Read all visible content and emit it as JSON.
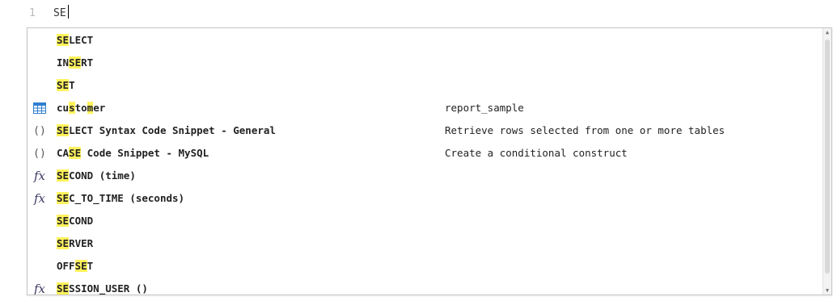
{
  "editor": {
    "line_number": "1",
    "text": "SE"
  },
  "autocomplete": {
    "items": [
      {
        "icon": "none",
        "label": "SELECT",
        "highlights": [
          [
            0,
            2
          ]
        ],
        "detail": ""
      },
      {
        "icon": "none",
        "label": "INSERT",
        "highlights": [
          [
            2,
            4
          ]
        ],
        "detail": ""
      },
      {
        "icon": "none",
        "label": "SET",
        "highlights": [
          [
            0,
            2
          ]
        ],
        "detail": ""
      },
      {
        "icon": "table-icon",
        "label": "customer",
        "highlights": [
          [
            2,
            3
          ],
          [
            5,
            6
          ]
        ],
        "detail": "report_sample"
      },
      {
        "icon": "snippet-icon",
        "label": "SELECT Syntax Code Snippet - General",
        "highlights": [
          [
            0,
            2
          ]
        ],
        "detail": "Retrieve rows selected from one or more tables"
      },
      {
        "icon": "snippet-icon",
        "label": "CASE Code Snippet - MySQL",
        "highlights": [
          [
            2,
            4
          ]
        ],
        "detail": "Create a conditional construct"
      },
      {
        "icon": "function-icon",
        "label": "SECOND (time)",
        "highlights": [
          [
            0,
            2
          ]
        ],
        "detail": ""
      },
      {
        "icon": "function-icon",
        "label": "SEC_TO_TIME (seconds)",
        "highlights": [
          [
            0,
            2
          ]
        ],
        "detail": ""
      },
      {
        "icon": "none",
        "label": "SECOND",
        "highlights": [
          [
            0,
            2
          ]
        ],
        "detail": ""
      },
      {
        "icon": "none",
        "label": "SERVER",
        "highlights": [
          [
            0,
            2
          ]
        ],
        "detail": ""
      },
      {
        "icon": "none",
        "label": "OFFSET",
        "highlights": [
          [
            3,
            5
          ]
        ],
        "detail": ""
      },
      {
        "icon": "function-icon",
        "label": "SESSION_USER ()",
        "highlights": [
          [
            0,
            2
          ]
        ],
        "detail": ""
      }
    ]
  },
  "colors": {
    "match_highlight": "#fff25c",
    "table_icon": "#2f7fd1",
    "function_icon": "#3b3b62"
  }
}
